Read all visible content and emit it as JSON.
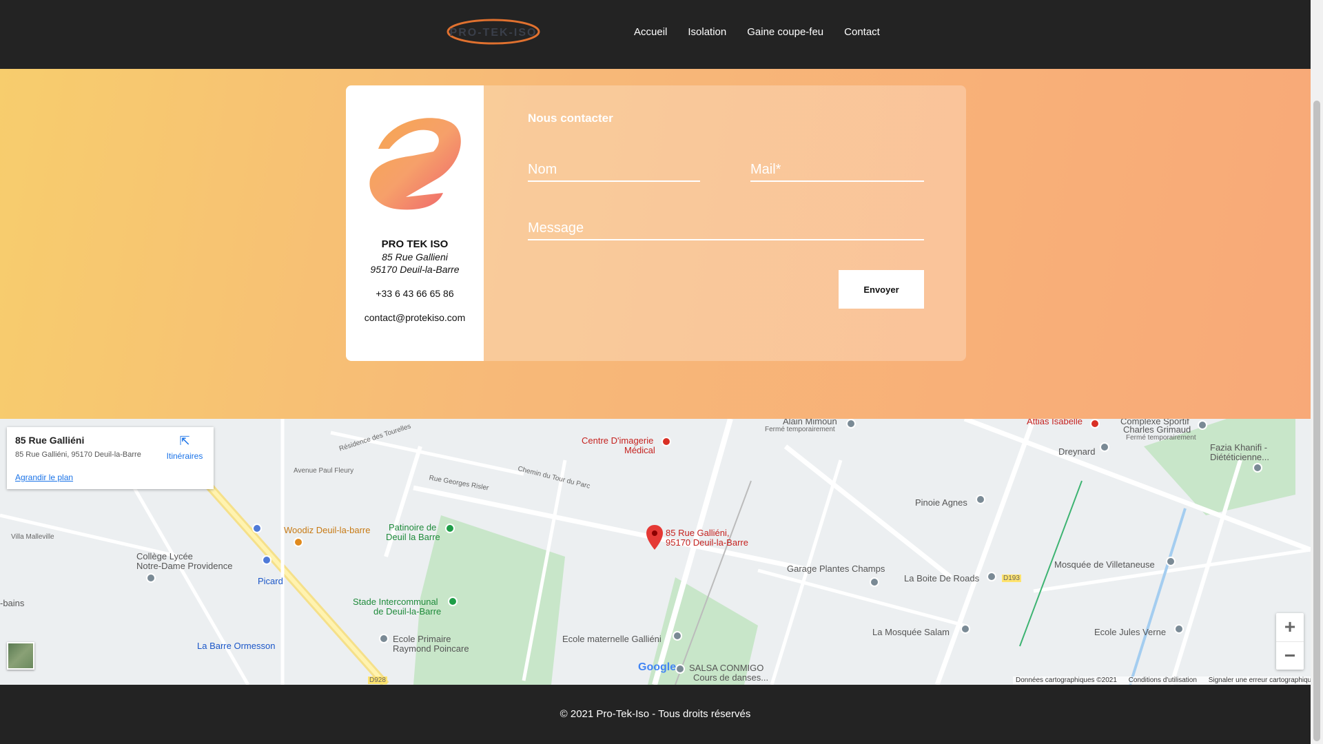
{
  "header": {
    "logo_text": "PRO-TEK-ISO",
    "nav": [
      "Accueil",
      "Isolation",
      "Gaine coupe-feu",
      "Contact"
    ]
  },
  "contact_card": {
    "company_name": "PRO TEK ISO",
    "address_line1": "85 Rue Gallieni",
    "address_line2": "95170 Deuil-la-Barre",
    "phone": "+33 6 43 66 65 86",
    "email": "contact@protekiso.com"
  },
  "form": {
    "title": "Nous contacter",
    "name_placeholder": "Nom",
    "mail_placeholder": "Mail*",
    "message_placeholder": "Message",
    "submit_label": "Envoyer"
  },
  "map": {
    "info_title": "85 Rue Galliéni",
    "info_address": "85 Rue Galliéni, 95170 Deuil-la-Barre",
    "info_directions": "Itinéraires",
    "info_enlarge": "Agrandir le plan",
    "pin_label_line1": "85 Rue Galliéni,",
    "pin_label_line2": "95170 Deuil-la-Barre",
    "labels": {
      "alain": "Alain Mimoun",
      "alain_sub": "Fermé temporairement",
      "attias": "Attias Isabelle",
      "complexe": "Complexe Sportif",
      "charles": "Charles Grimaud",
      "charles_sub": "Fermé temporairement",
      "fazia": "Fazia Khanifi -",
      "fazia2": "Diététicienne...",
      "dreynard": "Dreynard",
      "centre1": "Centre D'imagerie",
      "centre2": "Médical",
      "residence": "Résidence des Tourelles",
      "avenue": "Avenue Paul Fleury",
      "chemin": "Chemin du Tour du Parc",
      "georges": "Rue Georges Risler",
      "pinoie": "Pinoie Agnes",
      "woodiz": "Woodiz Deuil-la-barre",
      "patinoire1": "Patinoire de",
      "patinoire2": "Deuil la Barre",
      "college1": "Collège Lycée",
      "college2": "Notre-Dame Providence",
      "picard": "Picard",
      "villa": "Villa Malleville",
      "bains": "-bains",
      "stade1": "Stade Intercommunal",
      "stade2": "de Deuil-la-Barre",
      "garage": "Garage Plantes Champs",
      "laboite": "La Boite De Roads",
      "mosquee_v": "Mosquée de Villetaneuse",
      "ecole_m": "Ecole maternelle Galliéni",
      "ecole_p1": "Ecole Primaire",
      "ecole_p2": "Raymond Poincare",
      "barre": "La Barre Ormesson",
      "mosquee_s": "La Mosquée Salam",
      "ecole_j": "Ecole Jules Verne",
      "salsa1": "SALSA CONMIGO",
      "salsa2": "Cours de danses...",
      "d193": "D193",
      "d928": "D928"
    },
    "google": "Google",
    "footer_data": "Données cartographiques ©2021",
    "footer_terms": "Conditions d'utilisation",
    "footer_report": "Signaler une erreur cartographique",
    "zoom_in": "+",
    "zoom_out": "−"
  },
  "footer": {
    "copyright": "© 2021 Pro-Tek-Iso - Tous droits réservés"
  },
  "colors": {
    "header_bg": "#232323",
    "gradient_start": "#f7cd6d",
    "gradient_end": "#f8a978",
    "brand_orange": "#f39a4f",
    "brand_pink": "#ef5b6b"
  }
}
